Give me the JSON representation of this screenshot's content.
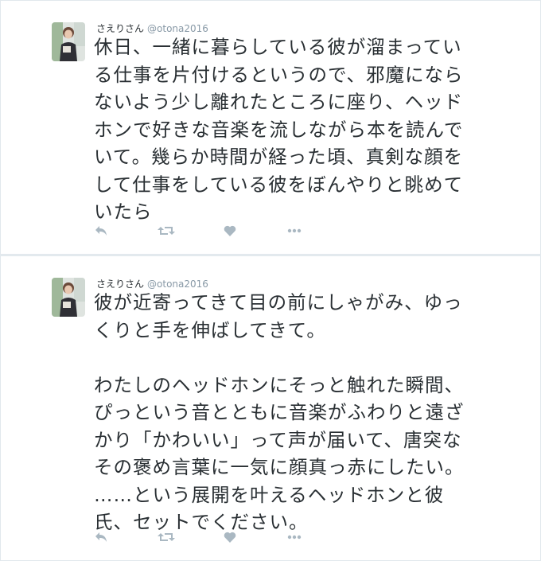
{
  "tweets": [
    {
      "fullname": "さえりさん",
      "username": "@otona2016",
      "text": "休日、一緒に暮らしている彼が溜まってい\nる仕事を片付けるというので、邪魔になら\nないよう少し離れたところに座り、ヘッド\nホンで好きな音楽を流しながら本を読んで\nいて。幾らか時間が経った頃、真剣な顔を\nして仕事をしている彼をぼんやりと眺めて\nいたら"
    },
    {
      "fullname": "さえりさん",
      "username": "@otona2016",
      "text": "彼が近寄ってきて目の前にしゃがみ、ゆっ\nくりと手を伸ばしてきて。\n\nわたしのヘッドホンにそっと触れた瞬間、\nぴっという音とともに音楽がふわりと遠ざ\nかり「かわいい」って声が届いて、唐突な\nその褒め言葉に一気に顔真っ赤にしたい。\n……という展開を叶えるヘッドホンと彼\n氏、セットでください。"
    }
  ],
  "icons": [
    "reply-icon",
    "retweet-icon",
    "like-icon",
    "more-icon"
  ],
  "colors": {
    "background": "#e6ecf0",
    "card": "#ffffff",
    "border": "#e1e8ed",
    "text": "#292f33",
    "secondary": "#8899a6",
    "icon": "#aab8c2"
  }
}
